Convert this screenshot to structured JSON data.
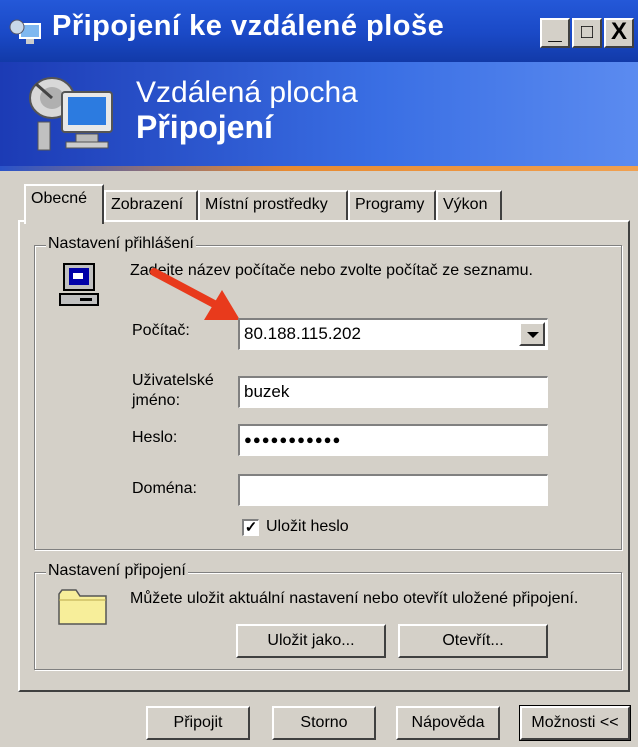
{
  "window": {
    "title": "Připojení ke vzdálené ploše",
    "controls": {
      "minimize": "_",
      "maximize": "□",
      "close": "X"
    }
  },
  "banner": {
    "line1": "Vzdálená plocha",
    "line2": "Připojení"
  },
  "tabs": [
    {
      "label": "Obecné",
      "active": true
    },
    {
      "label": "Zobrazení",
      "active": false
    },
    {
      "label": "Místní prostředky",
      "active": false
    },
    {
      "label": "Programy",
      "active": false
    },
    {
      "label": "Výkon",
      "active": false
    }
  ],
  "login_group": {
    "title": "Nastavení přihlášení",
    "instruction": "Zadejte název počítače nebo zvolte počítač ze seznamu.",
    "computer_label": "Počítač:",
    "computer_value": "80.188.115.202",
    "username_label_1": "Uživatelské",
    "username_label_2": "jméno:",
    "username_value": "buzek",
    "password_label": "Heslo:",
    "password_value": "●●●●●●●●●●●",
    "domain_label": "Doména:",
    "domain_value": "",
    "save_password_label": "Uložit heslo",
    "save_password_checked": true
  },
  "connection_group": {
    "title": "Nastavení připojení",
    "text": "Můžete uložit aktuální nastavení nebo otevřít uložené připojení.",
    "save_as_label": "Uložit jako...",
    "open_label": "Otevřít..."
  },
  "buttons": {
    "connect": "Připojit",
    "cancel": "Storno",
    "help": "Nápověda",
    "options": "Možnosti <<"
  },
  "icons": {
    "title_icon": "remote-desktop-icon",
    "banner_icon": "satellite-monitor-icon",
    "computer_icon": "computer-icon",
    "folder_icon": "folder-icon",
    "annotation": "red-arrow-icon"
  },
  "colors": {
    "titlebar": "#1a49c6",
    "dialog": "#d4d0c8",
    "arrow": "#e83a1c"
  }
}
